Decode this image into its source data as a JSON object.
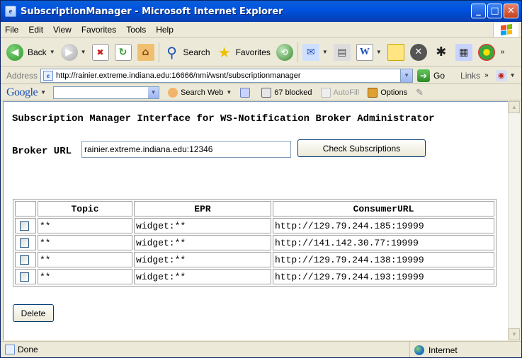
{
  "window": {
    "title": "SubscriptionManager - Microsoft Internet Explorer",
    "controls": {
      "minimize": "_",
      "maximize": "□",
      "close": "✕"
    }
  },
  "menu": {
    "items": [
      {
        "label": "File"
      },
      {
        "label": "Edit"
      },
      {
        "label": "View"
      },
      {
        "label": "Favorites"
      },
      {
        "label": "Tools"
      },
      {
        "label": "Help"
      }
    ]
  },
  "toolbar": {
    "back_label": "Back",
    "search_label": "Search",
    "favorites_label": "Favorites"
  },
  "address": {
    "label": "Address",
    "url": "http://rainier.extreme.indiana.edu:16666/nmi/wsnt/subscriptionmanager",
    "go_label": "Go",
    "links_label": "Links"
  },
  "googlebar": {
    "logo": "Google",
    "search_web_label": "Search Web",
    "blocked_label": "67 blocked",
    "autofill_label": "AutoFill",
    "options_label": "Options"
  },
  "page": {
    "heading": "Subscription Manager Interface for WS-Notification Broker Administrator",
    "broker_label": "Broker URL",
    "broker_value": "rainier.extreme.indiana.edu:12346",
    "check_button": "Check Subscriptions",
    "delete_button": "Delete",
    "table": {
      "columns": [
        "",
        "Topic",
        "EPR",
        "ConsumerURL"
      ],
      "rows": [
        {
          "topic": "**",
          "epr": "widget:**",
          "consumer": "http://129.79.244.185:19999"
        },
        {
          "topic": "**",
          "epr": "widget:**",
          "consumer": "http://141.142.30.77:19999"
        },
        {
          "topic": "**",
          "epr": "widget:**",
          "consumer": "http://129.79.244.138:19999"
        },
        {
          "topic": "**",
          "epr": "widget:**",
          "consumer": "http://129.79.244.193:19999"
        }
      ]
    }
  },
  "status": {
    "text": "Done",
    "zone": "Internet"
  }
}
